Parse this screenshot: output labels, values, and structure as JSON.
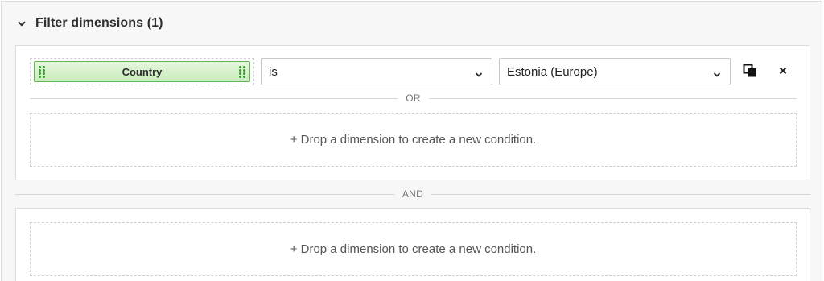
{
  "panel": {
    "title": "Filter dimensions (1)",
    "expanded": true
  },
  "groups": [
    {
      "condition": {
        "dimension": "Country",
        "operator": "is",
        "value": "Estonia (Europe)"
      },
      "or_label": "OR",
      "drop_hint": "+ Drop a dimension to create a new condition."
    },
    {
      "drop_hint": "+ Drop a dimension to create a new condition."
    }
  ],
  "and_label": "AND",
  "icons": {
    "collapse": "chevron-down-icon",
    "copy": "copy-icon",
    "remove": "close-icon",
    "drag": "drag-handle-icon"
  },
  "colors": {
    "chip_fill": "#d4f0c8",
    "chip_border": "#5fb650",
    "panel_bg": "#f7f7f7"
  }
}
